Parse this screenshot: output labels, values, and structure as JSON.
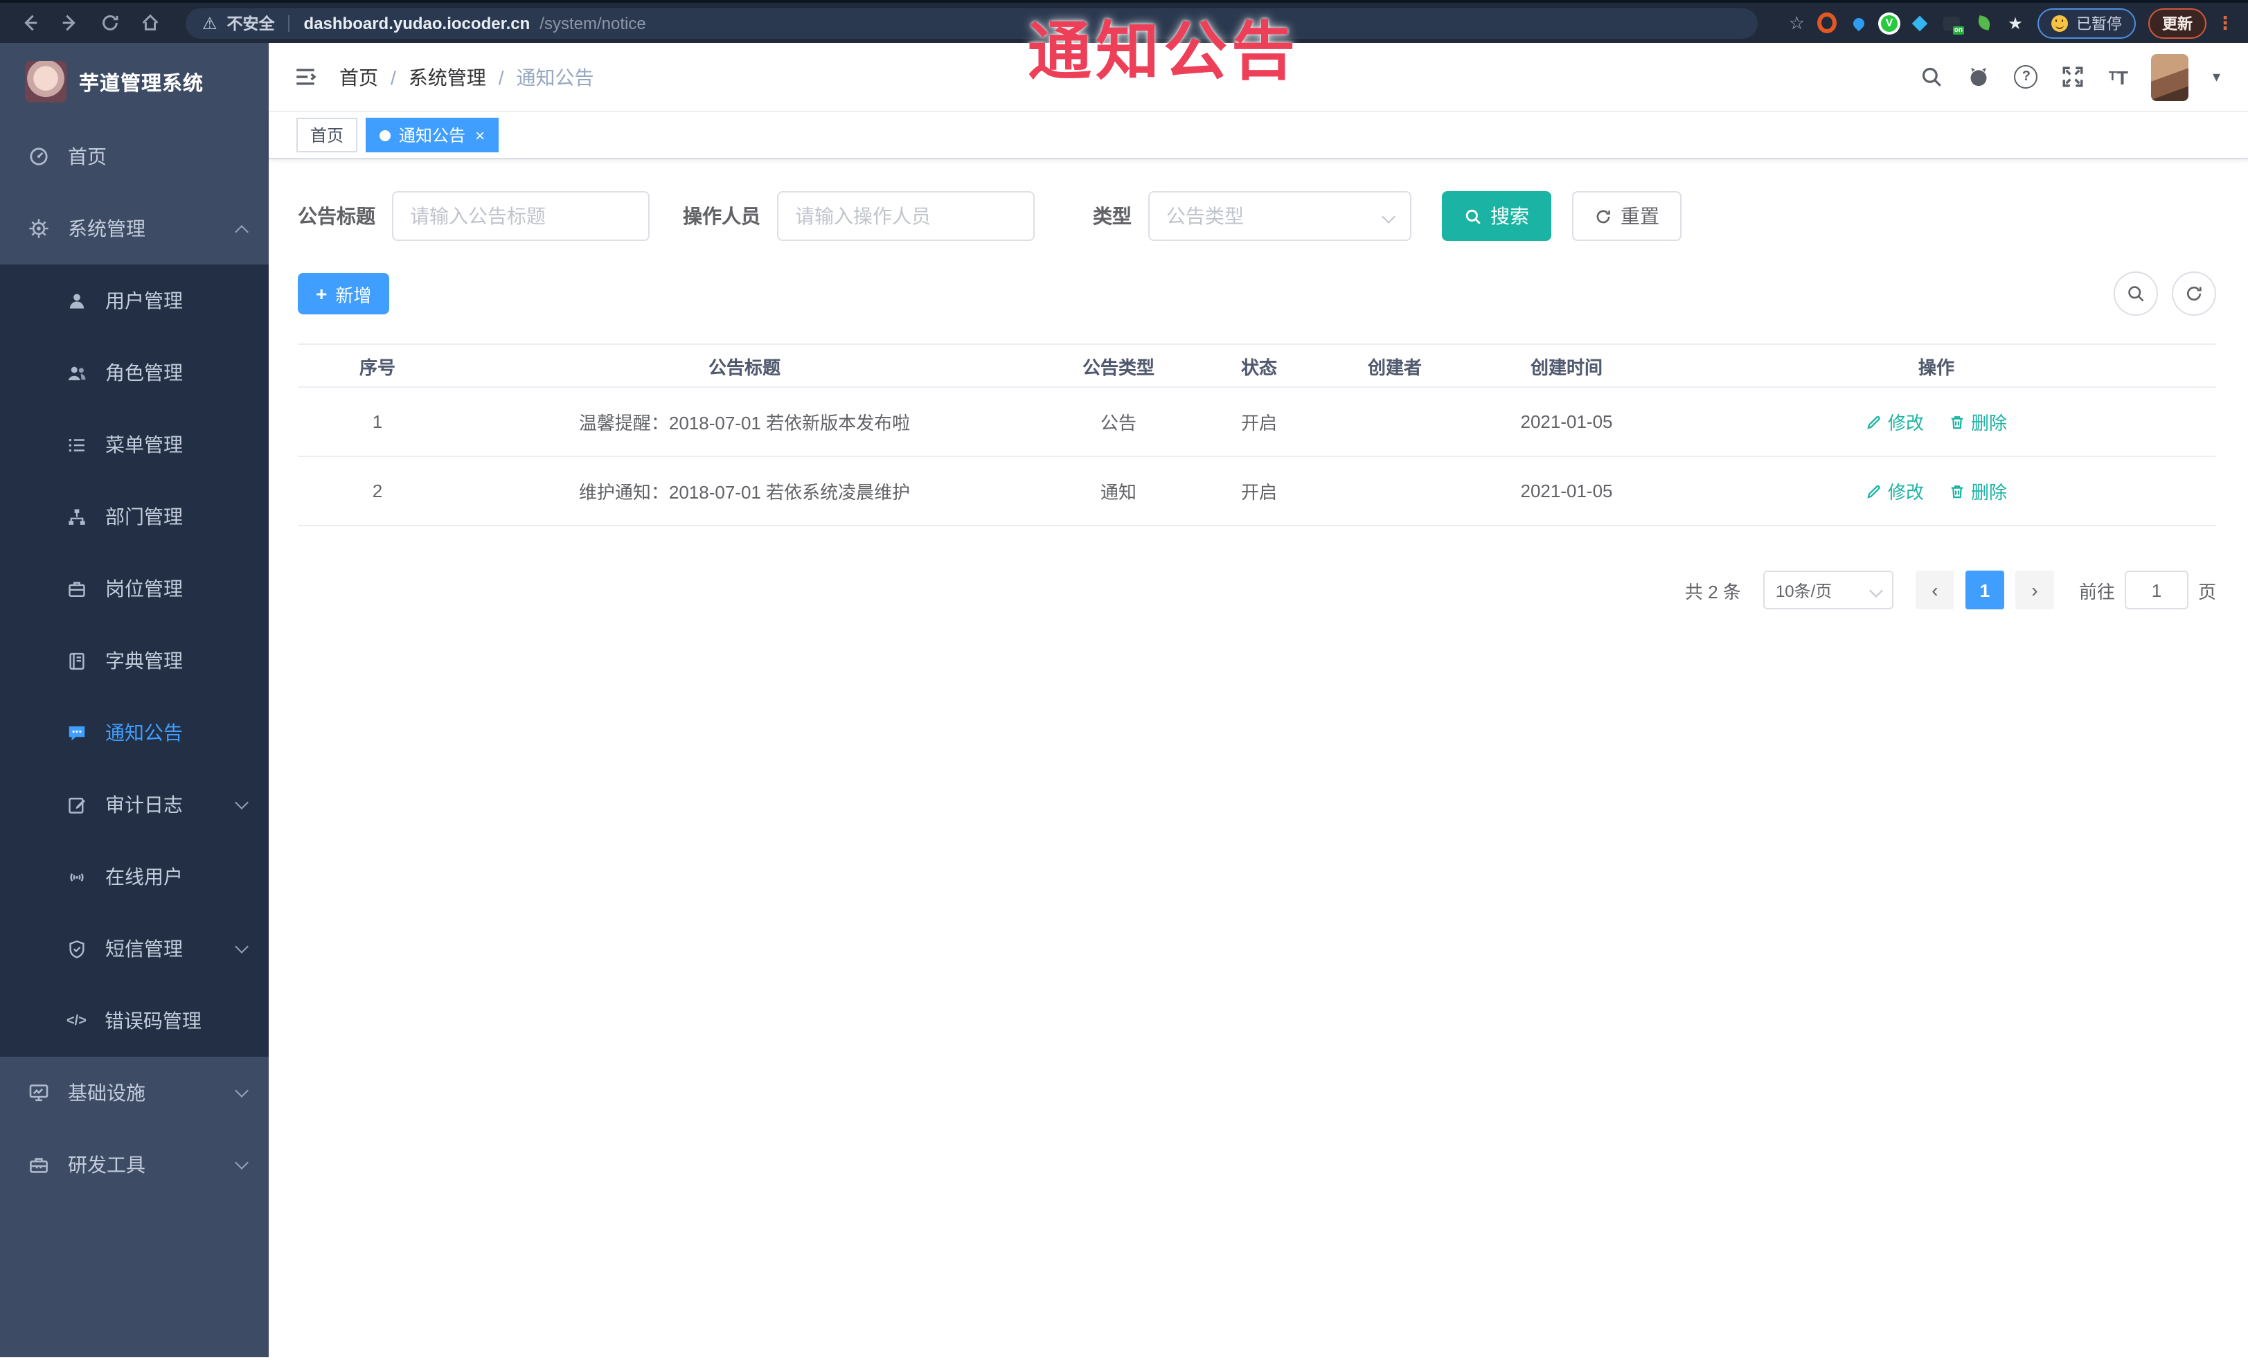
{
  "colors": {
    "accent": "#409eff",
    "teal": "#1bb3a3",
    "watermark_red": "#ee3f58",
    "sidebar_bg": "#3d4b64",
    "submenu_bg": "#222f44",
    "browser_bar": "#202a3a"
  },
  "watermark_text": "通知公告",
  "browser": {
    "security_label": "不安全",
    "url_host": "dashboard.yudao.iocoder.cn",
    "url_path": "/system/notice",
    "paused_badge_label": "已暂停",
    "update_button_label": "更新"
  },
  "icons": {
    "warning": "⚠",
    "plus": "+",
    "close": "×",
    "caret_down": "▾",
    "prev": "‹",
    "next": "›",
    "separator": "/",
    "question": "?",
    "code": "</>",
    "star": "★",
    "dots": "⋮",
    "ext_v": "V",
    "ext_on": "on"
  },
  "sidebar": {
    "app_title": "芋道管理系统",
    "items": [
      {
        "label": "首页"
      },
      {
        "label": "系统管理"
      },
      {
        "label": "用户管理"
      },
      {
        "label": "角色管理"
      },
      {
        "label": "菜单管理"
      },
      {
        "label": "部门管理"
      },
      {
        "label": "岗位管理"
      },
      {
        "label": "字典管理"
      },
      {
        "label": "通知公告"
      },
      {
        "label": "审计日志"
      },
      {
        "label": "在线用户"
      },
      {
        "label": "短信管理"
      },
      {
        "label": "错误码管理"
      },
      {
        "label": "基础设施"
      },
      {
        "label": "研发工具"
      }
    ]
  },
  "header": {
    "breadcrumb": [
      {
        "label": "首页"
      },
      {
        "label": "系统管理"
      },
      {
        "label": "通知公告"
      }
    ]
  },
  "tabs": [
    {
      "label": "首页"
    },
    {
      "label": "通知公告"
    }
  ],
  "filters": {
    "title_label": "公告标题",
    "title_placeholder": "请输入公告标题",
    "operator_label": "操作人员",
    "operator_placeholder": "请输入操作人员",
    "type_label": "类型",
    "type_placeholder": "公告类型",
    "search_label": "搜索",
    "reset_label": "重置"
  },
  "toolbar": {
    "add_label": "新增"
  },
  "table": {
    "headers": [
      "序号",
      "公告标题",
      "公告类型",
      "状态",
      "创建者",
      "创建时间",
      "操作"
    ],
    "rows": [
      {
        "no": "1",
        "title": "温馨提醒：2018-07-01 若依新版本发布啦",
        "type": "公告",
        "status": "开启",
        "creator": "",
        "created": "2021-01-05",
        "edit_label": "修改",
        "delete_label": "删除"
      },
      {
        "no": "2",
        "title": "维护通知：2018-07-01 若依系统凌晨维护",
        "type": "通知",
        "status": "开启",
        "creator": "",
        "created": "2021-01-05",
        "edit_label": "修改",
        "delete_label": "删除"
      }
    ]
  },
  "pagination": {
    "total_text": "共 2 条",
    "page_size": "10条/页",
    "current_page": "1",
    "goto_label": "前往",
    "goto_value": "1",
    "page_unit": "页"
  }
}
